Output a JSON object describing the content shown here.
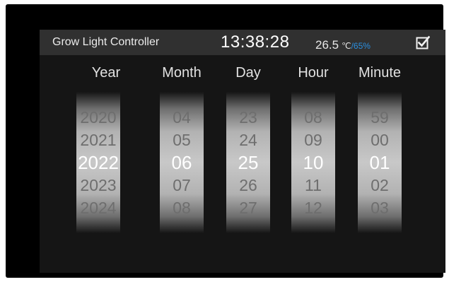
{
  "header": {
    "title": "Grow Light Controller",
    "time": "13:38:28",
    "temperature": "26.5",
    "temperature_unit": "℃",
    "separator": "/",
    "humidity": "65%",
    "confirm_icon": "checkbox-checked-icon"
  },
  "picker": {
    "columns": [
      {
        "label": "Year",
        "items": [
          "2020",
          "2021",
          "2022",
          "2023",
          "2024"
        ],
        "selected": "2022"
      },
      {
        "label": "Month",
        "items": [
          "04",
          "05",
          "06",
          "07",
          "08"
        ],
        "selected": "06"
      },
      {
        "label": "Day",
        "items": [
          "23",
          "24",
          "25",
          "26",
          "27"
        ],
        "selected": "25"
      },
      {
        "label": "Hour",
        "items": [
          "08",
          "09",
          "10",
          "11",
          "12"
        ],
        "selected": "10"
      },
      {
        "label": "Minute",
        "items": [
          "59",
          "00",
          "01",
          "02",
          "03"
        ],
        "selected": "01"
      }
    ]
  },
  "colors": {
    "bezel": "#000000",
    "screen": "#151515",
    "header": "#303030",
    "accent_humidity": "#2a8fe0",
    "selected_text": "#ffffff",
    "unselected_text": "#6e6e6e"
  }
}
